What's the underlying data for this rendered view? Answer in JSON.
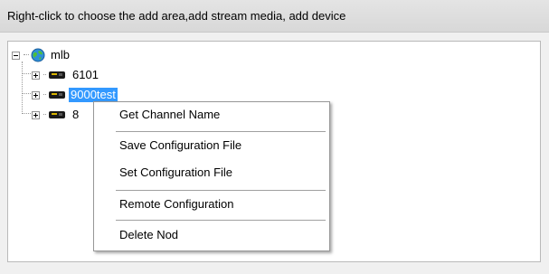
{
  "header": {
    "text": "Right-click to choose the add area,add stream media, add device"
  },
  "tree": {
    "root": {
      "label": "mlb",
      "icon": "globe-icon",
      "expanded": true
    },
    "children": [
      {
        "label": "6101",
        "icon": "device-icon",
        "expanded": false,
        "selected": false
      },
      {
        "label": "9000test",
        "icon": "device-icon",
        "expanded": false,
        "selected": true
      },
      {
        "label": "8",
        "icon": "device-icon",
        "expanded": false,
        "selected": false
      }
    ]
  },
  "context_menu": {
    "items": [
      {
        "label": "Get Channel Name"
      },
      {
        "label": "Save Configuration File"
      },
      {
        "label": "Set Configuration File"
      },
      {
        "label": "Remote Configuration"
      },
      {
        "label": "Delete Nod"
      }
    ]
  },
  "colors": {
    "selection": "#3399ff",
    "header_bg": "#dcdcdc",
    "panel_bg": "#f0f0f0"
  }
}
